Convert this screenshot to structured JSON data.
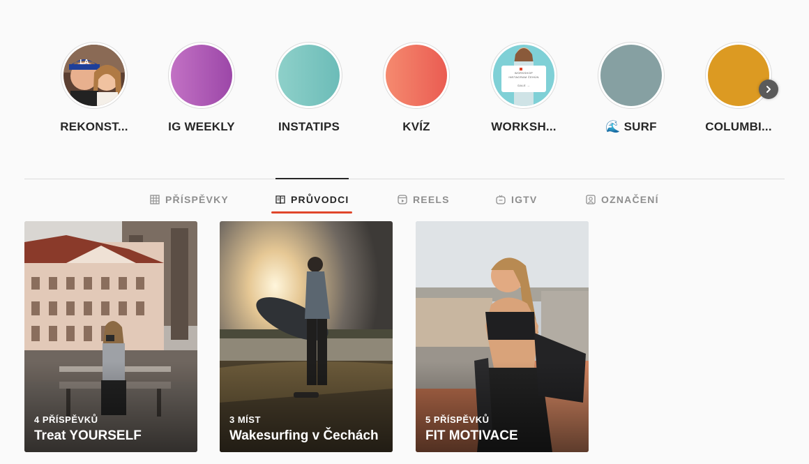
{
  "highlights": [
    {
      "label": "REKONST...",
      "color": "#6b4a3a"
    },
    {
      "label": "IG WEEKLY",
      "color": "#a855b0"
    },
    {
      "label": "INSTATIPS",
      "color": "#7cc4bf"
    },
    {
      "label": "KVÍZ",
      "color": "#ee6f5c"
    },
    {
      "label": "WORKSH...",
      "color": "#7fd0d6",
      "preview_line1": "WORKSHOP",
      "preview_line2": "INSTAGRAM ČEHÚN",
      "preview_cta": "DALE →"
    },
    {
      "label": "🌊 SURF",
      "color": "#86a0a2"
    },
    {
      "label": "COLUMBI...",
      "color": "#dc9a22"
    }
  ],
  "tabs": [
    {
      "label": "PŘÍSPĚVKY",
      "icon": "grid-icon",
      "active": false
    },
    {
      "label": "PRŮVODCI",
      "icon": "guide-book-icon",
      "active": true
    },
    {
      "label": "REELS",
      "icon": "reels-icon",
      "active": false
    },
    {
      "label": "IGTV",
      "icon": "igtv-icon",
      "active": false
    },
    {
      "label": "OZNAČENÍ",
      "icon": "tagged-person-icon",
      "active": false
    }
  ],
  "guides": [
    {
      "count": "4 PŘÍSPĚVKŮ",
      "title": "Treat YOURSELF"
    },
    {
      "count": "3 MÍST",
      "title": "Wakesurfing v Čechách"
    },
    {
      "count": "5 PŘÍSPĚVKŮ",
      "title": "FIT MOTIVACE"
    }
  ],
  "colors": {
    "accent_underline": "#e0462b",
    "text_primary": "#262626",
    "text_muted": "#8e8e8e",
    "background": "#fafafa"
  }
}
